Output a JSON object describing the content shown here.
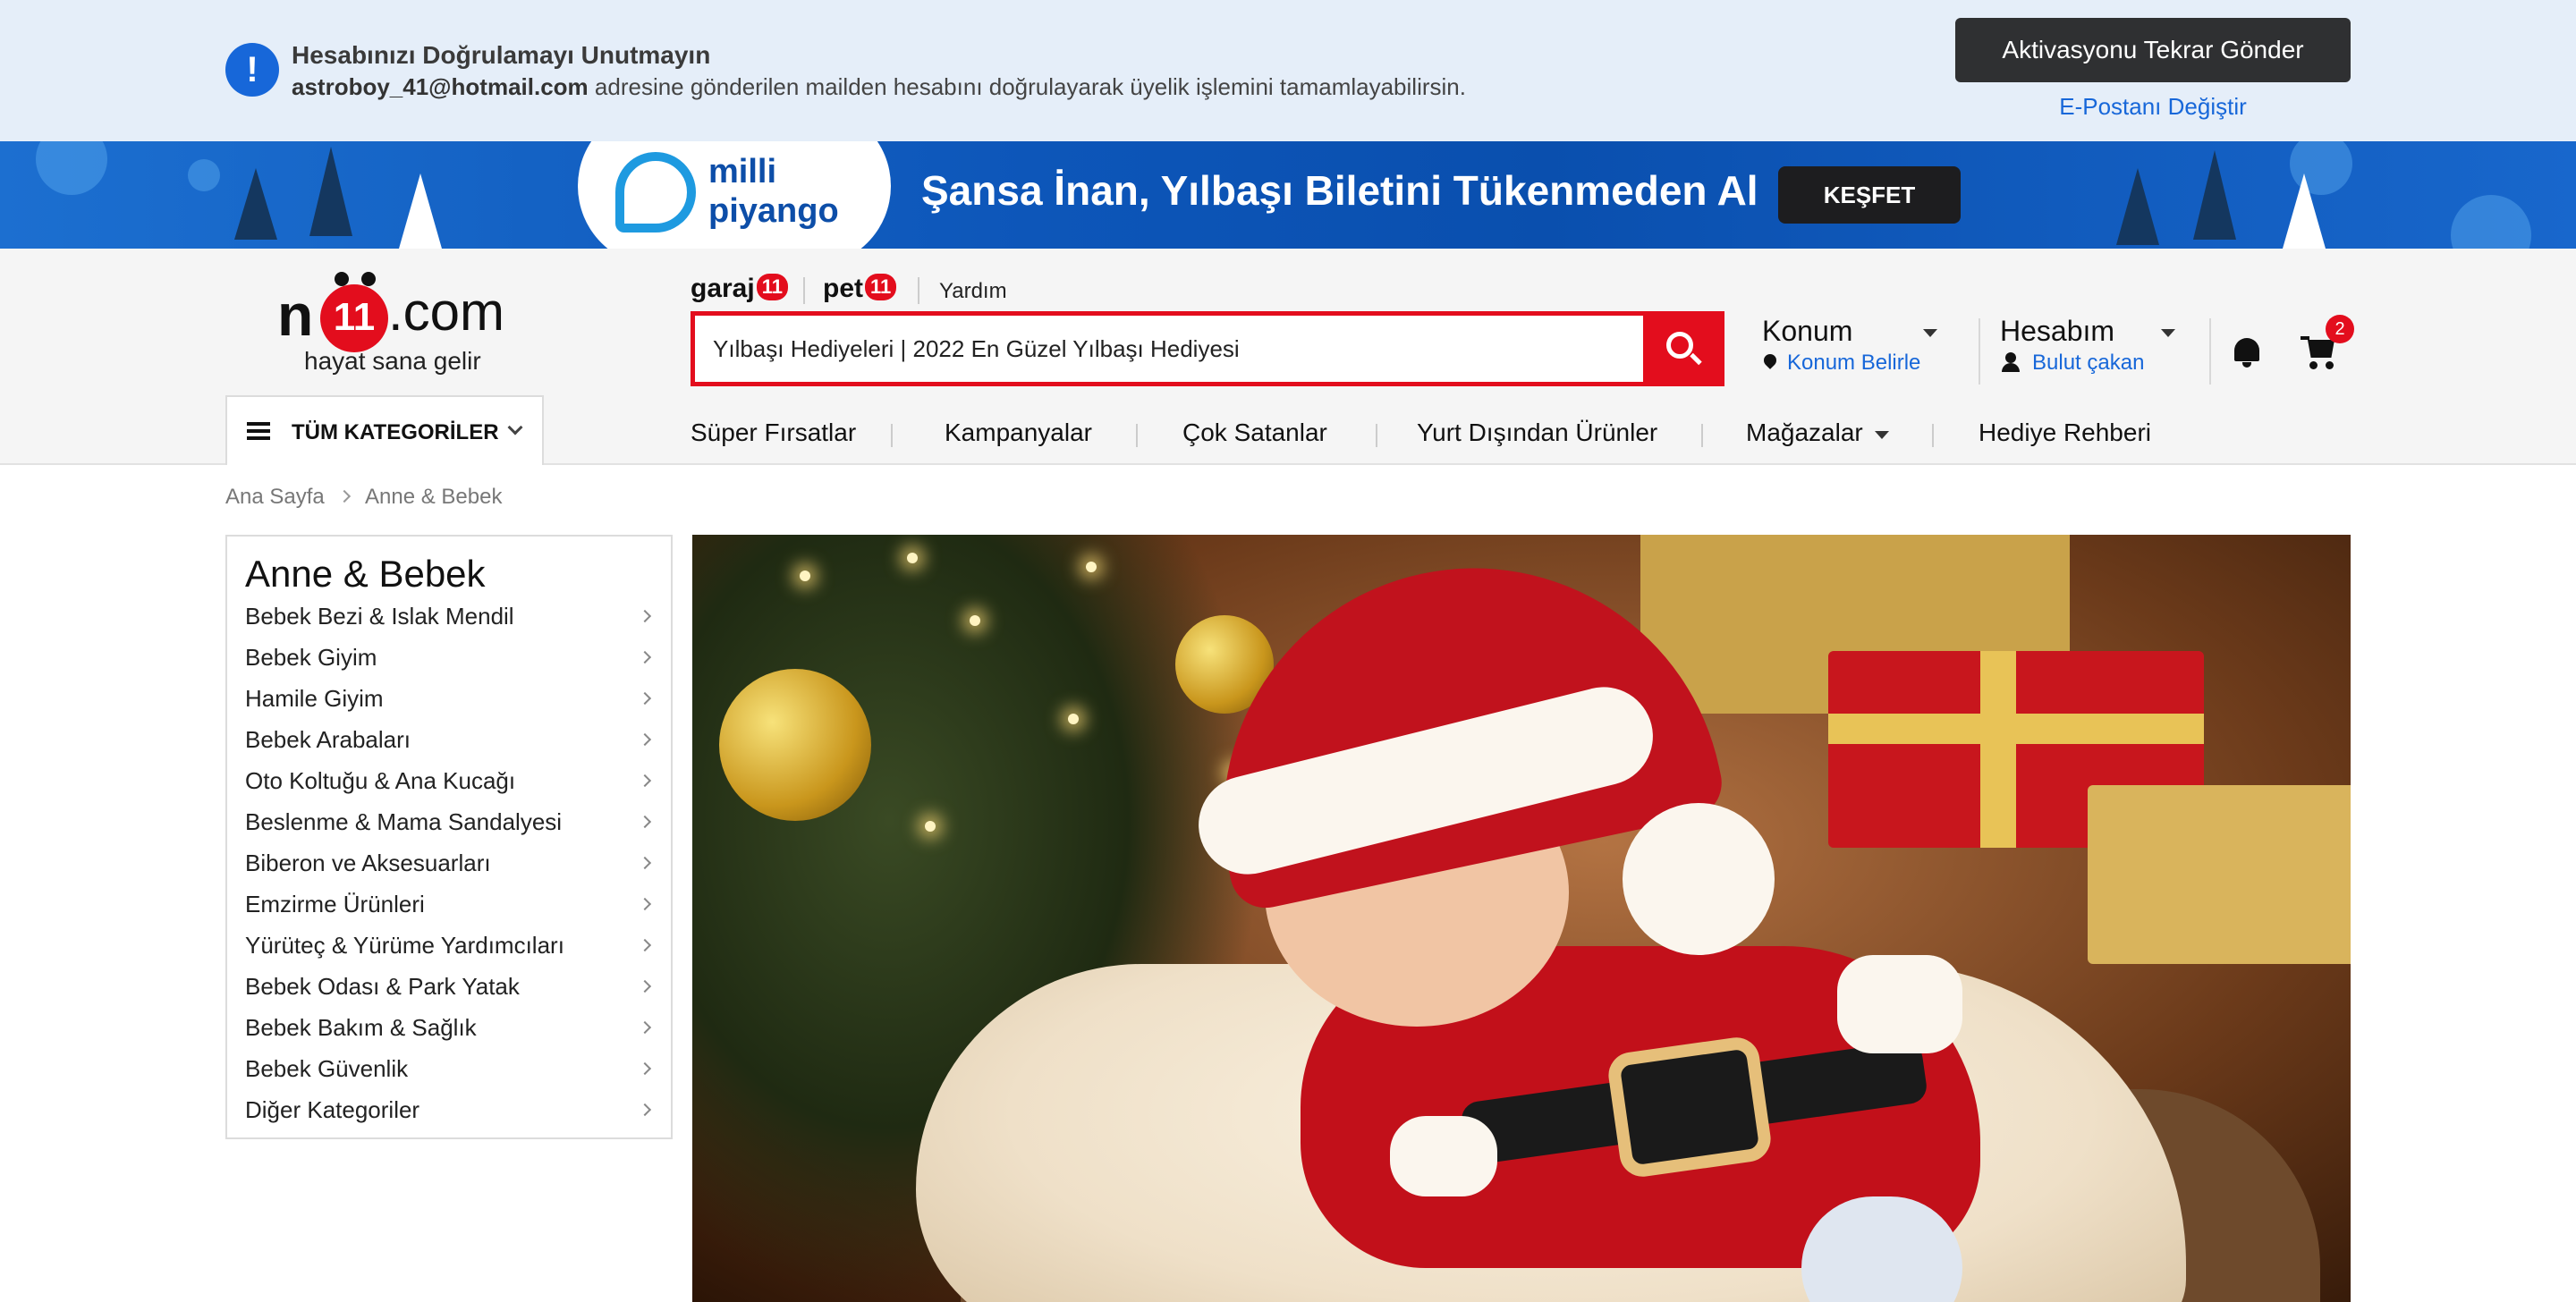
{
  "verify_banner": {
    "title": "Hesabınızı Doğrulamayı Unutmayın",
    "email": "astroboy_41@hotmail.com",
    "description": "adresine gönderilen mailden hesabını doğrulayarak üyelik işlemini tamamlayabilirsin.",
    "resend_button": "Aktivasyonu Tekrar Gönder",
    "change_email_link": "E-Postanı Değiştir",
    "icon": "exclamation-icon"
  },
  "promo_banner": {
    "brand_line1": "milli",
    "brand_line2": "piyango",
    "slogan": "Şansa İnan, Yılbaşı Biletini Tükenmeden Al",
    "button": "KEŞFET"
  },
  "header": {
    "logo": {
      "n": "n",
      "eleven": "11",
      "com": ".com"
    },
    "tagline": "hayat sana gelir",
    "sub_links": {
      "garaj": "garaj",
      "garaj_badge": "11",
      "pet": "pet",
      "pet_badge": "11",
      "help": "Yardım"
    },
    "search": {
      "value": "Yılbaşı Hediyeleri | 2022 En Güzel Yılbaşı Hediyesi"
    },
    "location": {
      "title": "Konum",
      "subtitle": "Konum Belirle"
    },
    "account": {
      "title": "Hesabım",
      "subtitle": "Bulut çakan"
    },
    "cart_count": "2",
    "all_categories": "TÜM KATEGORİLER",
    "nav": [
      {
        "label": "Süper Fırsatlar"
      },
      {
        "label": "Kampanyalar"
      },
      {
        "label": "Çok Satanlar"
      },
      {
        "label": "Yurt Dışından Ürünler"
      },
      {
        "label": "Mağazalar"
      },
      {
        "label": "Hediye Rehberi"
      }
    ]
  },
  "breadcrumb": {
    "home": "Ana Sayfa",
    "current": "Anne & Bebek"
  },
  "sidebar": {
    "title": "Anne & Bebek",
    "items": [
      {
        "label": "Bebek Bezi & Islak Mendil"
      },
      {
        "label": "Bebek Giyim"
      },
      {
        "label": "Hamile Giyim"
      },
      {
        "label": "Bebek Arabaları"
      },
      {
        "label": "Oto Koltuğu & Ana Kucağı"
      },
      {
        "label": "Beslenme & Mama Sandalyesi"
      },
      {
        "label": "Biberon ve Aksesuarları"
      },
      {
        "label": "Emzirme Ürünleri"
      },
      {
        "label": "Yürüteç & Yürüme Yardımcıları"
      },
      {
        "label": "Bebek Odası & Park Yatak"
      },
      {
        "label": "Bebek Bakım & Sağlık"
      },
      {
        "label": "Bebek Güvenlik"
      },
      {
        "label": "Diğer Kategoriler"
      }
    ]
  },
  "colors": {
    "brand_red": "#e30d1d",
    "link_blue": "#1767d9",
    "verify_bg": "#e5eef9",
    "dark_button": "#2f3032"
  }
}
